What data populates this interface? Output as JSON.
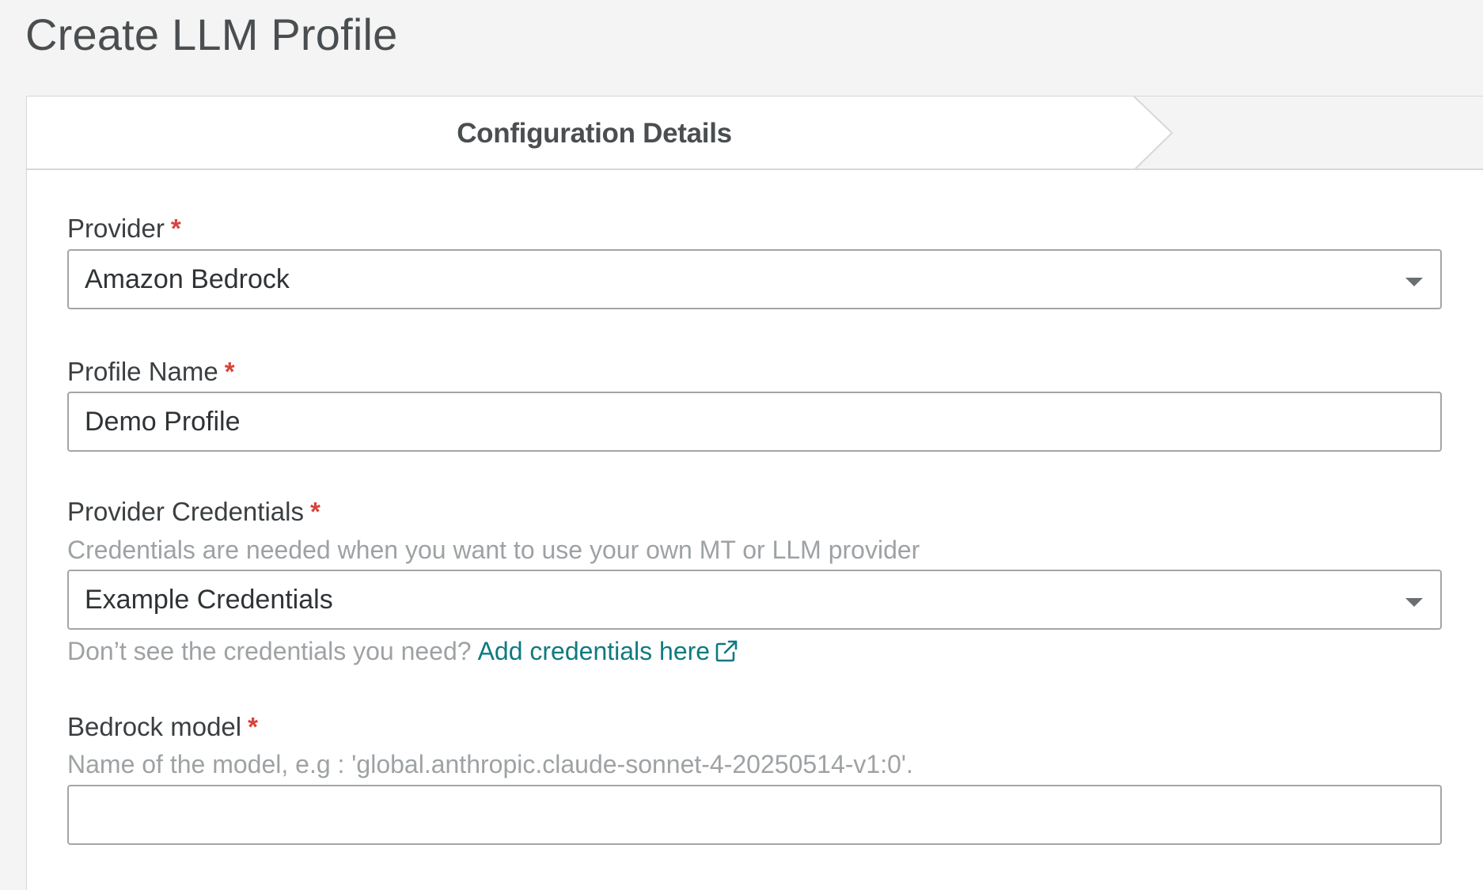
{
  "page": {
    "title": "Create LLM Profile"
  },
  "stepper": {
    "steps": [
      {
        "label": "Configuration Details",
        "active": true
      },
      {
        "label": "",
        "active": false
      }
    ]
  },
  "form": {
    "provider": {
      "label": "Provider",
      "required_mark": "*",
      "value": "Amazon Bedrock"
    },
    "profile_name": {
      "label": "Profile Name",
      "required_mark": "*",
      "value": "Demo Profile"
    },
    "credentials": {
      "label": "Provider Credentials",
      "required_mark": "*",
      "hint": "Credentials are needed when you want to use your own MT or LLM provider",
      "value": "Example Credentials",
      "help_text": "Don’t see the credentials you need?",
      "help_link": "Add credentials here",
      "help_link_icon": "external-link-icon"
    },
    "bedrock_model": {
      "label": "Bedrock model",
      "required_mark": "*",
      "hint": "Name of the model, e.g : 'global.anthropic.claude-sonnet-4-20250514-v1:0'.",
      "value": "",
      "placeholder": ""
    }
  },
  "colors": {
    "background": "#f3f4f3",
    "card": "#ffffff",
    "required": "#d9433b",
    "link": "#0f7b80",
    "hint": "#9ea2a4"
  }
}
